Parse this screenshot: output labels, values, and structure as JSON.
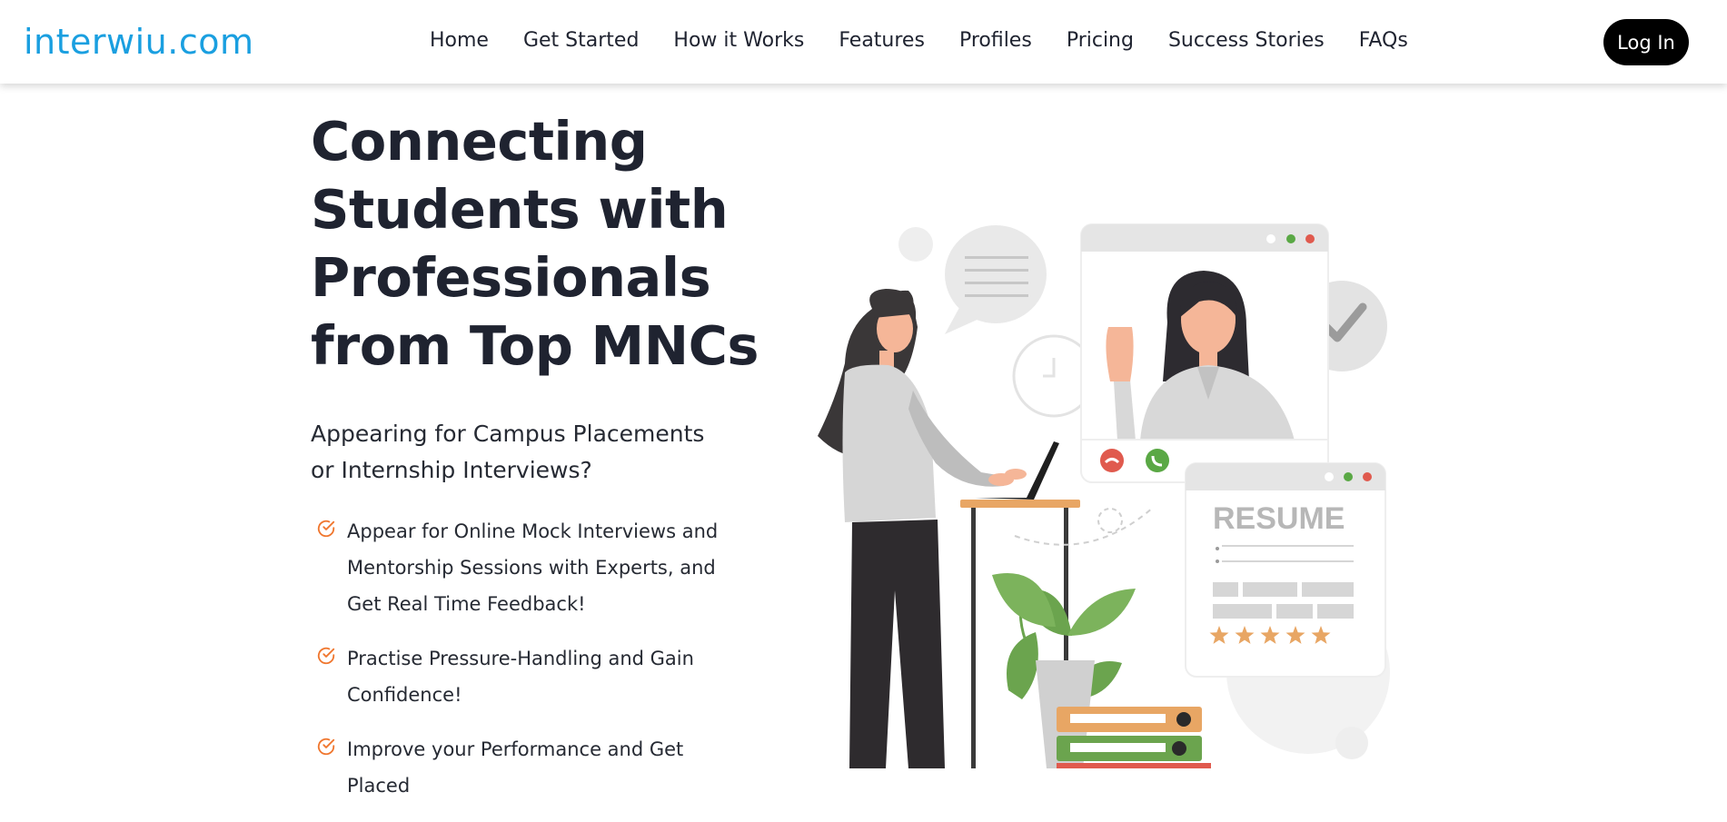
{
  "header": {
    "logo": "interwiu.com",
    "nav": [
      "Home",
      "Get Started",
      "How it Works",
      "Features",
      "Profiles",
      "Pricing",
      "Success Stories",
      "FAQs"
    ],
    "login_label": "Log In"
  },
  "hero": {
    "title_lines": [
      "Connecting",
      "Students with",
      "Professionals",
      "from Top MNCs"
    ],
    "subtitle_lines": [
      "Appearing for Campus Placements",
      "or Internship Interviews?"
    ],
    "features": [
      "Appear for Online Mock Interviews and Mentorship Sessions with Experts, and Get Real Time Feedback!",
      "Practise Pressure-Handling and Gain Confidence!",
      "Improve your Performance and Get Placed"
    ],
    "check_icon": "check-circle-icon"
  },
  "illustration": {
    "resume_label": "RESUME",
    "rating_stars": 5
  },
  "colors": {
    "brand": "#1a9fe0",
    "accent_orange": "#f0772f",
    "text": "#1f2330",
    "star": "#e8a664",
    "call_end": "#e05a4e",
    "call_accept": "#5aa845"
  }
}
